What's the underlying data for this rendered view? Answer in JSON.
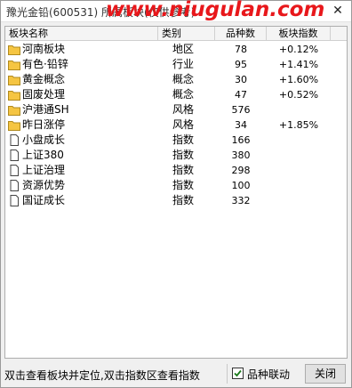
{
  "window": {
    "title": "豫光金铅(600531) 所属板块(仅供参考)",
    "watermark": "www.niugulan.com",
    "close_glyph": "✕"
  },
  "table": {
    "headers": [
      "板块名称",
      "类别",
      "品种数",
      "板块指数"
    ],
    "rows": [
      {
        "icon": "folder-icon",
        "name": "河南板块",
        "type": "地区",
        "count": "78",
        "change": "+0.12%"
      },
      {
        "icon": "folder-icon",
        "name": "有色·铅锌",
        "type": "行业",
        "count": "95",
        "change": "+1.41%"
      },
      {
        "icon": "folder-icon",
        "name": "黄金概念",
        "type": "概念",
        "count": "30",
        "change": "+1.60%"
      },
      {
        "icon": "folder-icon",
        "name": "固废处理",
        "type": "概念",
        "count": "47",
        "change": "+0.52%"
      },
      {
        "icon": "folder-icon",
        "name": "沪港通SH",
        "type": "风格",
        "count": "576",
        "change": ""
      },
      {
        "icon": "folder-icon",
        "name": "昨日涨停",
        "type": "风格",
        "count": "34",
        "change": "+1.85%"
      },
      {
        "icon": "document-icon",
        "name": "小盘成长",
        "type": "指数",
        "count": "166",
        "change": ""
      },
      {
        "icon": "document-icon",
        "name": "上证380",
        "type": "指数",
        "count": "380",
        "change": ""
      },
      {
        "icon": "document-icon",
        "name": "上证治理",
        "type": "指数",
        "count": "298",
        "change": ""
      },
      {
        "icon": "document-icon",
        "name": "资源优势",
        "type": "指数",
        "count": "100",
        "change": ""
      },
      {
        "icon": "document-icon",
        "name": "国证成长",
        "type": "指数",
        "count": "332",
        "change": ""
      }
    ]
  },
  "status": {
    "hint": "双击查看板块并定位,双击指数区查看指数",
    "checkbox_label": "品种联动",
    "checkbox_checked": true,
    "close_button": "关闭"
  },
  "colors": {
    "watermark": "#e8171b",
    "folder": "#f5c542",
    "check": "#1a7a1a"
  }
}
